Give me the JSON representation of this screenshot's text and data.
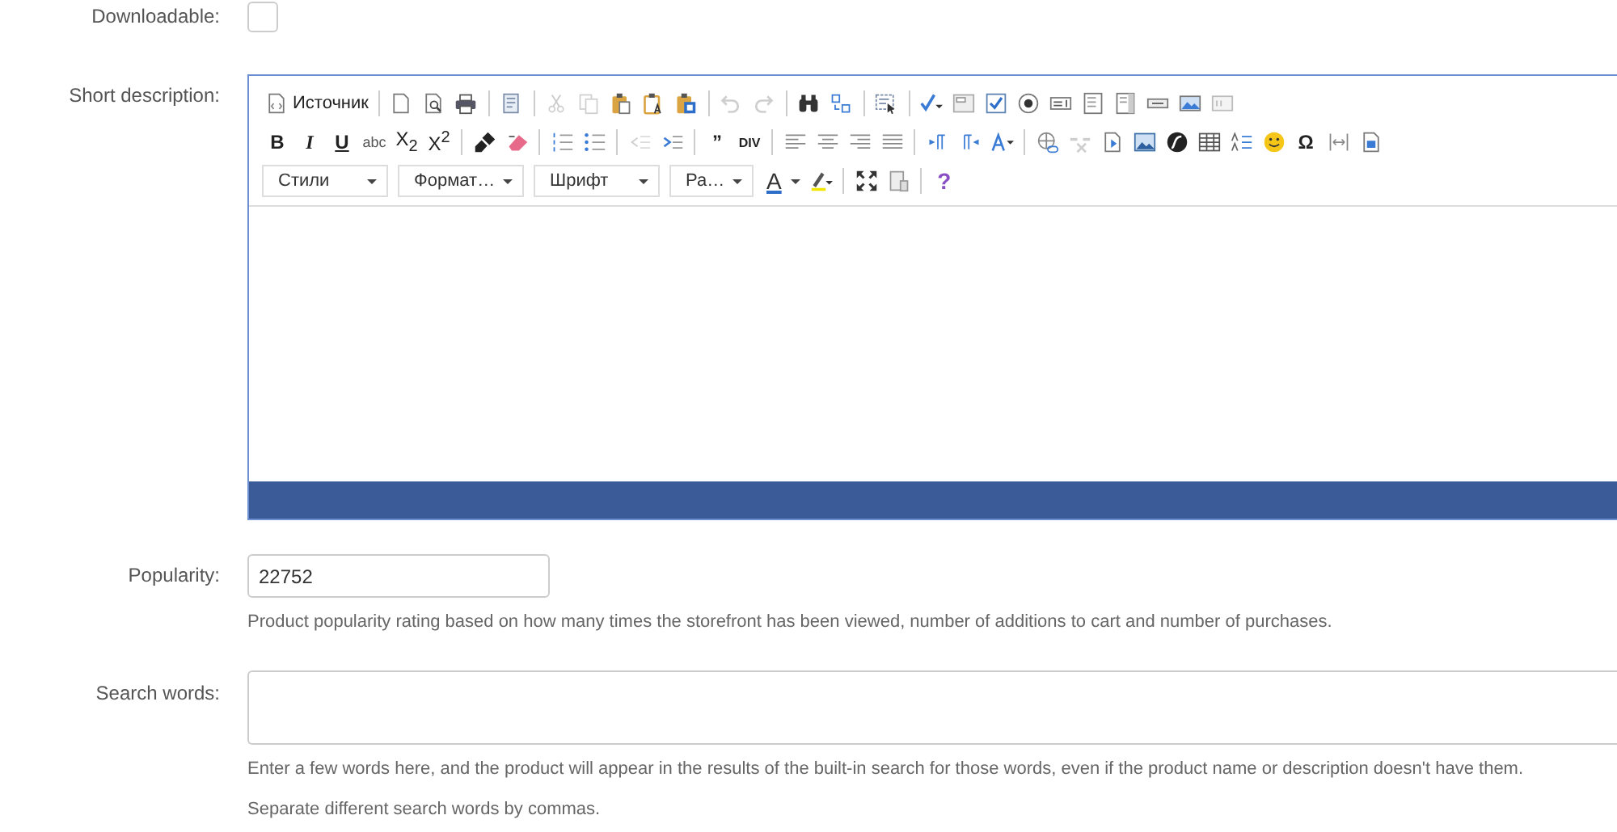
{
  "fields": [
    {
      "kind": "checkbox",
      "label": "Downloadable:",
      "checked": false
    },
    {
      "kind": "editor",
      "label": "Short description:",
      "toolbar": [
        [
          {
            "kind": "source",
            "text": "Источник",
            "disabled": false
          },
          {
            "kind": "sep"
          },
          {
            "kind": "icon",
            "disabled": false
          },
          {
            "kind": "icon",
            "disabled": false
          },
          {
            "kind": "icon",
            "disabled": false
          },
          {
            "kind": "sep"
          },
          {
            "kind": "icon",
            "disabled": false
          },
          {
            "kind": "sep"
          },
          {
            "kind": "icon",
            "disabled": true
          },
          {
            "kind": "icon",
            "disabled": true
          },
          {
            "kind": "icon",
            "disabled": false
          },
          {
            "kind": "icon",
            "disabled": false
          },
          {
            "kind": "icon",
            "disabled": false
          },
          {
            "kind": "sep"
          },
          {
            "kind": "icon",
            "disabled": true
          },
          {
            "kind": "icon",
            "disabled": true
          },
          {
            "kind": "sep"
          },
          {
            "kind": "icon",
            "disabled": false
          },
          {
            "kind": "icon",
            "disabled": false
          },
          {
            "kind": "sep"
          },
          {
            "kind": "icon",
            "disabled": false
          },
          {
            "kind": "sep"
          },
          {
            "kind": "icon",
            "disabled": false
          },
          {
            "kind": "icon",
            "disabled": false
          },
          {
            "kind": "icon",
            "disabled": false
          },
          {
            "kind": "icon",
            "disabled": false
          },
          {
            "kind": "icon",
            "disabled": false
          },
          {
            "kind": "icon",
            "disabled": false
          },
          {
            "kind": "icon",
            "disabled": false
          },
          {
            "kind": "icon",
            "disabled": false
          },
          {
            "kind": "icon",
            "disabled": false
          },
          {
            "kind": "icon",
            "disabled": false
          }
        ],
        [
          {
            "kind": "bold",
            "text": "B",
            "disabled": false
          },
          {
            "kind": "italic",
            "text": "I",
            "disabled": false
          },
          {
            "kind": "underline",
            "text": "U",
            "disabled": false
          },
          {
            "kind": "strike",
            "text": "abc",
            "disabled": false
          },
          {
            "kind": "script",
            "text": "X$_{2}$",
            "disabled": false
          },
          {
            "kind": "script",
            "text": "X$^{2}$",
            "disabled": false
          },
          {
            "kind": "sep"
          },
          {
            "kind": "icon",
            "disabled": false
          },
          {
            "kind": "icon",
            "disabled": false
          },
          {
            "kind": "sep"
          },
          {
            "kind": "icon",
            "disabled": false
          },
          {
            "kind": "icon",
            "disabled": false
          },
          {
            "kind": "sep"
          },
          {
            "kind": "icon",
            "disabled": true
          },
          {
            "kind": "icon",
            "disabled": false
          },
          {
            "kind": "sep"
          },
          {
            "kind": "quote",
            "text": "”",
            "disabled": false
          },
          {
            "kind": "div",
            "text": "DIV",
            "disabled": false
          },
          {
            "kind": "sep"
          },
          {
            "kind": "icon",
            "disabled": false
          },
          {
            "kind": "icon",
            "disabled": false
          },
          {
            "kind": "icon",
            "disabled": false
          },
          {
            "kind": "icon",
            "disabled": false
          },
          {
            "kind": "sep"
          },
          {
            "kind": "icon",
            "disabled": false
          },
          {
            "kind": "icon",
            "disabled": false
          },
          {
            "kind": "icon",
            "disabled": false
          },
          {
            "kind": "sep"
          },
          {
            "kind": "icon",
            "disabled": false
          },
          {
            "kind": "icon",
            "disabled": true
          },
          {
            "kind": "icon",
            "disabled": false
          },
          {
            "kind": "icon",
            "disabled": false
          },
          {
            "kind": "icon",
            "disabled": false
          },
          {
            "kind": "icon",
            "disabled": false
          },
          {
            "kind": "icon",
            "disabled": false
          },
          {
            "kind": "icon",
            "disabled": false
          },
          {
            "kind": "symbol",
            "text": "Ω",
            "disabled": false
          },
          {
            "kind": "icon",
            "disabled": false
          },
          {
            "kind": "icon",
            "disabled": false
          }
        ],
        [
          {
            "kind": "combo",
            "text": "Стили"
          },
          {
            "kind": "combo",
            "text": "Формат…"
          },
          {
            "kind": "combo",
            "text": "Шрифт"
          },
          {
            "kind": "combo",
            "text": "Ра…"
          },
          {
            "kind": "textcolor",
            "text": "A",
            "disabled": false
          },
          {
            "kind": "icon",
            "disabled": false
          },
          {
            "kind": "sep"
          },
          {
            "kind": "icon",
            "disabled": false
          },
          {
            "kind": "icon",
            "disabled": false
          },
          {
            "kind": "sep"
          },
          {
            "kind": "help",
            "text": "?",
            "disabled": false
          }
        ]
      ]
    },
    {
      "kind": "input",
      "label": "Popularity:",
      "value": "22752",
      "help": [
        "Product popularity rating based on how many times the storefront has been viewed, number of additions to cart and number of purchases."
      ]
    },
    {
      "kind": "textarea",
      "label": "Search words:",
      "help": [
        "Enter a few words here, and the product will appear in the results of the built-in search for those words, even if the product name or description doesn't have them.",
        "Separate different search words by commas."
      ]
    }
  ]
}
